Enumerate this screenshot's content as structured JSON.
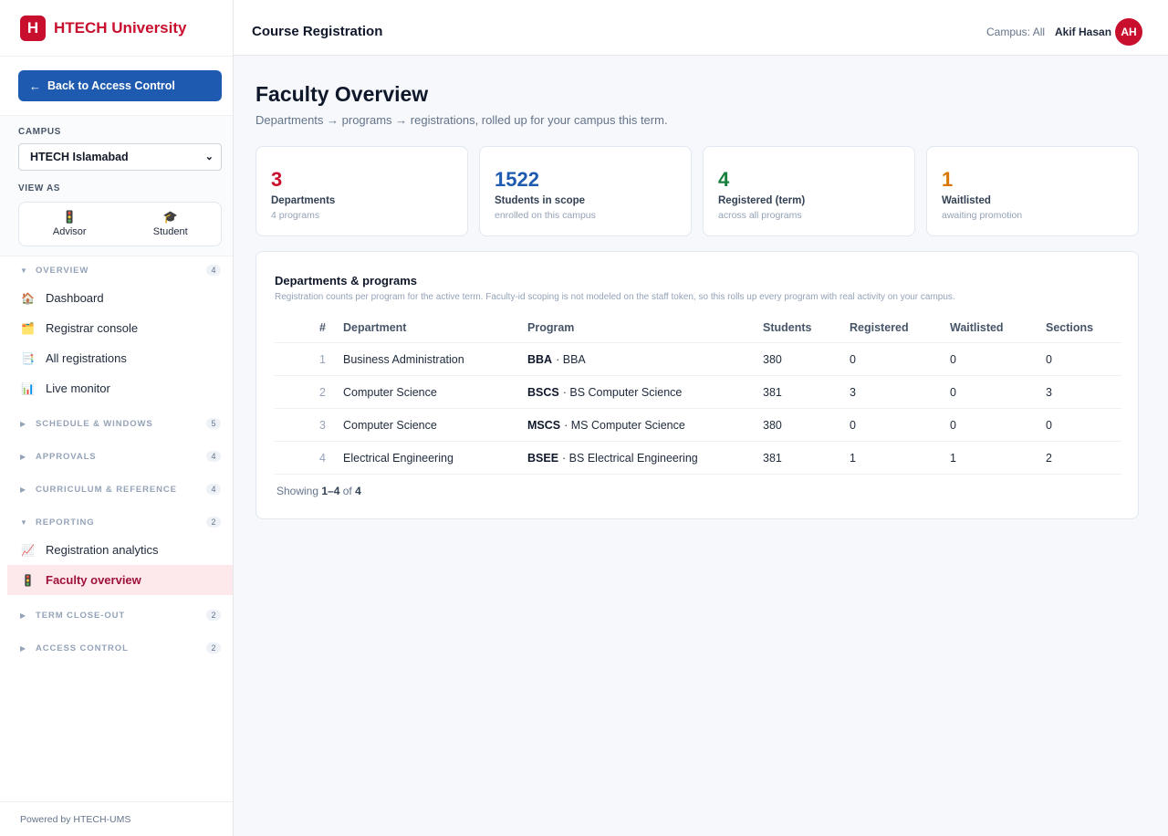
{
  "brand": {
    "logo_letter": "H",
    "name": "HTECH University",
    "color": "#c8102e"
  },
  "sidebar": {
    "back_label": "Back to Access Control",
    "campus_label": "CAMPUS",
    "campus_value": "HTECH Islamabad",
    "view_as_label": "VIEW AS",
    "view_options": [
      {
        "label": "Advisor",
        "icon": "🚦"
      },
      {
        "label": "Student",
        "icon": "🎓"
      }
    ],
    "groups": {
      "overview": {
        "label": "OVERVIEW",
        "count": "4",
        "expanded": true
      },
      "schedule": {
        "label": "SCHEDULE & WINDOWS",
        "count": "5",
        "expanded": false
      },
      "approvals": {
        "label": "APPROVALS",
        "count": "4",
        "expanded": false
      },
      "curriculum": {
        "label": "CURRICULUM & REFERENCE",
        "count": "4",
        "expanded": false
      },
      "reporting": {
        "label": "REPORTING",
        "count": "2",
        "expanded": true
      },
      "closeout": {
        "label": "TERM CLOSE-OUT",
        "count": "2",
        "expanded": false
      },
      "access": {
        "label": "ACCESS CONTROL",
        "count": "2",
        "expanded": false
      }
    },
    "items": {
      "dashboard": {
        "label": "Dashboard",
        "icon": "🏠"
      },
      "registrar": {
        "label": "Registrar console",
        "icon": "🗂️"
      },
      "all_reg": {
        "label": "All registrations",
        "icon": "📑"
      },
      "monitor": {
        "label": "Live monitor",
        "icon": "📊"
      },
      "analytics": {
        "label": "Registration analytics",
        "icon": "📈"
      },
      "faculty": {
        "label": "Faculty overview",
        "icon": "🚦",
        "active": true
      }
    },
    "powered_by": "Powered by HTECH-UMS"
  },
  "header": {
    "title": "Course Registration",
    "campus": "Campus: All",
    "user_name": "Akif Hasan",
    "avatar_initials": "AH"
  },
  "main": {
    "title": "Faculty Overview",
    "subtitle": "Departments → programs → registrations, rolled up for your campus this term.",
    "stats": [
      {
        "value": "3",
        "label": "Departments",
        "sub": "4 programs",
        "color": "#c8102e"
      },
      {
        "value": "1522",
        "label": "Students in scope",
        "sub": "enrolled on this campus",
        "color": "#1e5bb0"
      },
      {
        "value": "4",
        "label": "Registered (term)",
        "sub": "across all programs",
        "color": "#15803d"
      },
      {
        "value": "1",
        "label": "Waitlisted",
        "sub": "awaiting promotion",
        "color": "#d97706"
      }
    ],
    "table": {
      "title": "Departments & programs",
      "subtitle": "Registration counts per program for the active term. Faculty-id scoping is not modeled on the staff token, so this rolls up every program with real activity on your campus.",
      "columns": [
        "#",
        "Department",
        "Program",
        "Students",
        "Registered",
        "Waitlisted",
        "Sections"
      ],
      "rows": [
        {
          "num": "1",
          "department": "Business Administration",
          "program_code": "BBA",
          "program_name": "· BBA",
          "students": "380",
          "registered": "0",
          "waitlisted": "0",
          "sections": "0"
        },
        {
          "num": "2",
          "department": "Computer Science",
          "program_code": "BSCS",
          "program_name": "· BS Computer Science",
          "students": "381",
          "registered": "3",
          "waitlisted": "0",
          "sections": "3"
        },
        {
          "num": "3",
          "department": "Computer Science",
          "program_code": "MSCS",
          "program_name": "· MS Computer Science",
          "students": "380",
          "registered": "0",
          "waitlisted": "0",
          "sections": "0"
        },
        {
          "num": "4",
          "department": "Electrical Engineering",
          "program_code": "BSEE",
          "program_name": "· BS Electrical Engineering",
          "students": "381",
          "registered": "1",
          "waitlisted": "1",
          "sections": "2"
        }
      ],
      "showing_prefix": "Showing",
      "showing_range": "1–4",
      "showing_of": "of",
      "showing_total": "4"
    }
  }
}
